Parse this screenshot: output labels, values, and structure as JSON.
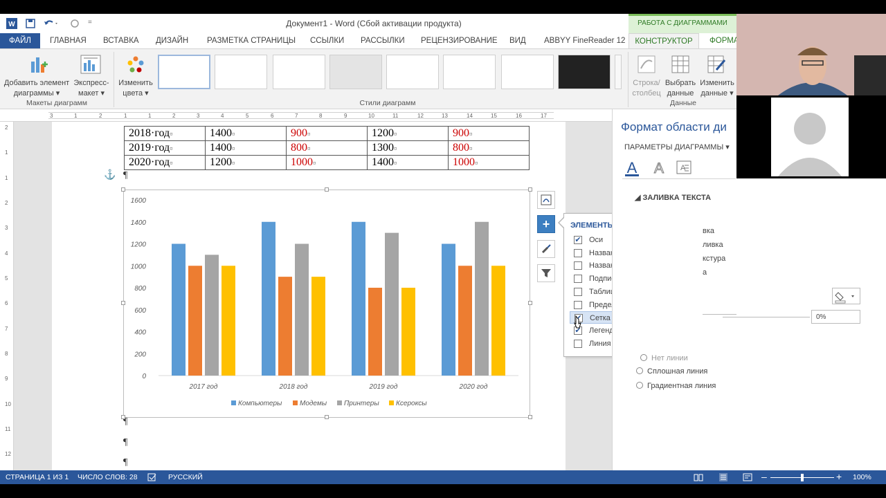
{
  "window": {
    "title": "Документ1 - Word (Сбой активации продукта)",
    "context_group": "РАБОТА С ДИАГРАММАМИ",
    "qat_more": "=",
    "icons": [
      "word-app-icon",
      "save-icon",
      "undo-icon",
      "redo-icon"
    ]
  },
  "tabs": [
    {
      "label": "ФАЙЛ"
    },
    {
      "label": "ГЛАВНАЯ"
    },
    {
      "label": "ВСТАВКА"
    },
    {
      "label": "ДИЗАЙН"
    },
    {
      "label": "РАЗМЕТКА СТРАНИЦЫ"
    },
    {
      "label": "ССЫЛКИ"
    },
    {
      "label": "РАССЫЛКИ"
    },
    {
      "label": "РЕЦЕНЗИРОВАНИЕ"
    },
    {
      "label": "ВИД"
    },
    {
      "label": "ABBYY FineReader 12"
    },
    {
      "label": "КОНСТРУКТОР"
    },
    {
      "label": "ФОРМА"
    }
  ],
  "ribbon": {
    "add_element_l1": "Добавить элемент",
    "add_element_l2": "диаграммы ▾",
    "express_l1": "Экспресс-",
    "express_l2": "макет ▾",
    "group_layouts": "Макеты диаграмм",
    "change_colors_l1": "Изменить",
    "change_colors_l2": "цвета ▾",
    "group_styles": "Стили диаграмм",
    "row_col_l1": "Строка/",
    "row_col_l2": "столбец",
    "select_data_l1": "Выбрать",
    "select_data_l2": "данные",
    "edit_data_l1": "Изменить",
    "edit_data_l2": "данные ▾",
    "group_data": "Данные"
  },
  "ruler": {
    "h_marks": [
      "3",
      "1",
      "2",
      "1",
      "1",
      "2",
      "3",
      "4",
      "5",
      "6",
      "7",
      "8",
      "9",
      "10",
      "11",
      "12",
      "13",
      "14",
      "15",
      "16",
      "17"
    ],
    "v_marks": [
      "2",
      "1",
      "1",
      "2",
      "3",
      "4",
      "5",
      "6",
      "7",
      "8",
      "9",
      "10",
      "11",
      "12",
      "13"
    ]
  },
  "table": {
    "rows": [
      [
        "2018·год",
        "1400",
        "900",
        "1200",
        "900"
      ],
      [
        "2019·год",
        "1400",
        "800",
        "1300",
        "800"
      ],
      [
        "2020·год",
        "1200",
        "1000",
        "1400",
        "1000"
      ]
    ],
    "red_columns": [
      2,
      4
    ],
    "cell_mark": "¤"
  },
  "pilcrow": "¶",
  "anchor": "⚓",
  "chart_data": {
    "type": "bar",
    "categories": [
      "2017 год",
      "2018 год",
      "2019 год",
      "2020 год"
    ],
    "series": [
      {
        "name": "Компьютеры",
        "color": "#5b9bd5",
        "values": [
          1200,
          1400,
          1400,
          1200
        ]
      },
      {
        "name": "Модемы",
        "color": "#ed7d31",
        "values": [
          1000,
          900,
          800,
          1000
        ]
      },
      {
        "name": "Принтеры",
        "color": "#a5a5a5",
        "values": [
          1100,
          1200,
          1300,
          1400
        ]
      },
      {
        "name": "Ксероксы",
        "color": "#ffc000",
        "values": [
          1000,
          900,
          800,
          1000
        ]
      }
    ],
    "y_ticks": [
      "0",
      "200",
      "400",
      "600",
      "800",
      "1000",
      "1200",
      "1400",
      "1600"
    ],
    "ylim": [
      0,
      1600
    ],
    "grid": false,
    "legend": "bottom",
    "title": "",
    "xlabel": "",
    "ylabel": ""
  },
  "chart_tools": {
    "plus": "+",
    "icons": [
      "chart-layout-icon",
      "chart-elements-plus-icon",
      "chart-styles-brush-icon",
      "chart-filter-icon"
    ]
  },
  "flyout": {
    "title": "ЭЛЕМЕНТЫ ДИАГРАММЫ",
    "check": "✔",
    "submenu": "▶",
    "items": [
      {
        "label": "Оси",
        "checked": true
      },
      {
        "label": "Названия осей",
        "checked": false
      },
      {
        "label": "Название диаграммы",
        "checked": false
      },
      {
        "label": "Подписи данных",
        "checked": false
      },
      {
        "label": "Таблица данных",
        "checked": false
      },
      {
        "label": "Предел погрешностей",
        "checked": false
      },
      {
        "label": "Сетка",
        "checked": true
      },
      {
        "label": "Легенда",
        "checked": true
      },
      {
        "label": "Линия тренда",
        "checked": false
      }
    ]
  },
  "panel": {
    "title": "Формат области ди",
    "subtitle": "ПАРАМЕТРЫ ДИАГРАММЫ ▾",
    "section": "◢  ЗАЛИВКА ТЕКСТА",
    "partial_options": [
      "вка",
      "ливка",
      "кстура",
      "а"
    ],
    "percent": "0%",
    "line_options": [
      "Нет линии",
      "Сплошная линия",
      "Градиентная линия"
    ]
  },
  "status": {
    "page": "СТРАНИЦА 1 ИЗ 1",
    "words": "ЧИСЛО СЛОВ: 28",
    "lang": "РУССКИЙ",
    "zoom": "100%",
    "zoom_level": 1.0
  }
}
